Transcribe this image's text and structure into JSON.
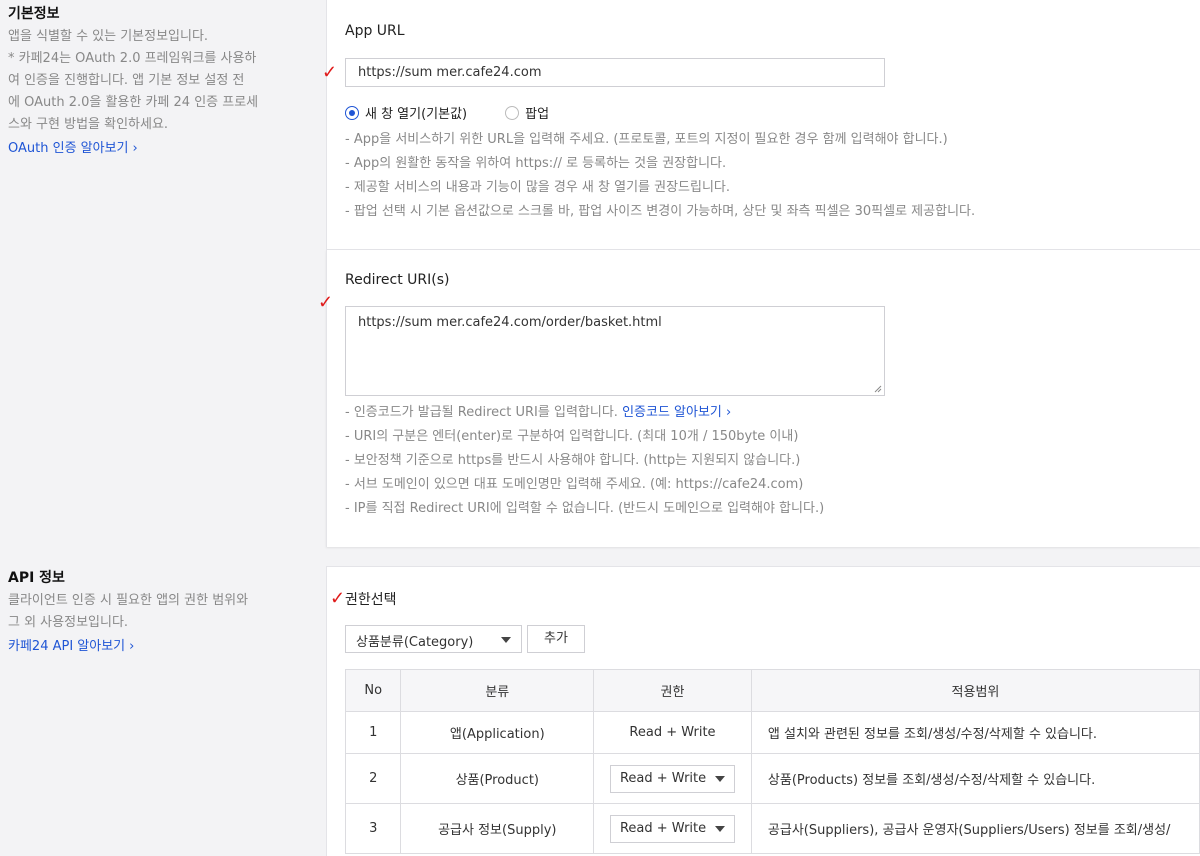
{
  "basic_info": {
    "heading": "기본정보",
    "desc_lines": [
      "앱을 식별할 수 있는 기본정보입니다.",
      "* 카페24는 OAuth 2.0 프레임워크를 사용하",
      "여 인증을 진행합니다. 앱 기본 정보 설정 전",
      "에 OAuth 2.0을 활용한 카페 24 인증 프로세",
      "스와 구현 방법을 확인하세요."
    ],
    "link_label": "OAuth 인증 알아보기",
    "link_chevron": "›"
  },
  "app_url": {
    "label": "App URL",
    "value": "https://sum mer.cafe24.com",
    "options": [
      "새 창 열기(기본값)",
      "팝업"
    ],
    "selected_option": "새 창 열기(기본값)",
    "guides": [
      "- App을 서비스하기 위한 URL을 입력해 주세요. (프로토콜, 포트의 지정이 필요한 경우 함께 입력해야 합니다.)",
      "- App의 원활한 동작을 위하여 https:// 로 등록하는 것을 권장합니다.",
      "- 제공할 서비스의 내용과 기능이 많을 경우 새 창 열기를 권장드립니다.",
      "- 팝업 선택 시 기본 옵션값으로 스크롤 바, 팝업 사이즈 변경이 가능하며, 상단 및 좌측 픽셀은 30픽셀로 제공합니다."
    ]
  },
  "redirect": {
    "label": "Redirect URI(s)",
    "value": "https://sum mer.cafe24.com/order/basket.html",
    "guide_first": "- 인증코드가 발급될 Redirect URI를 입력합니다.",
    "guide_link": "인증코드 알아보기 ›",
    "guides": [
      "- URI의 구분은 엔터(enter)로 구분하여 입력합니다. (최대 10개 / 150byte 이내)",
      "- 보안정책 기준으로 https를 반드시 사용해야 합니다. (http는 지원되지 않습니다.)",
      "- 서브 도메인이 있으면 대표 도메인명만 입력해 주세요. (예: https://cafe24.com)",
      "- IP를 직접 Redirect URI에 입력할 수 없습니다. (반드시 도메인으로 입력해야 합니다.)"
    ]
  },
  "api_info": {
    "heading": "API 정보",
    "desc_lines": [
      "클라이언트 인증 시 필요한 앱의 권한 범위와",
      "그 외 사용정보입니다."
    ],
    "link_label": "카페24 API 알아보기",
    "link_chevron": "›"
  },
  "permissions": {
    "label": "권한선택",
    "select_value": "상품분류(Category)",
    "add_button": "추가",
    "columns": [
      "No",
      "분류",
      "권한",
      "적용범위"
    ],
    "rows": [
      {
        "no": "1",
        "category": "앱(Application)",
        "perm": "Read + Write",
        "perm_select": false,
        "scope": "앱 설치와 관련된 정보를 조회/생성/수정/삭제할 수 있습니다."
      },
      {
        "no": "2",
        "category": "상품(Product)",
        "perm": "Read + Write",
        "perm_select": true,
        "scope": "상품(Products) 정보를 조회/생성/수정/삭제할 수 있습니다."
      },
      {
        "no": "3",
        "category": "공급사 정보(Supply)",
        "perm": "Read + Write",
        "perm_select": true,
        "scope": "공급사(Suppliers), 공급사 운영자(Suppliers/Users) 정보를 조회/생성/"
      }
    ]
  },
  "annotations": {
    "check_mark": "✓",
    "color": "#e01b1b"
  }
}
